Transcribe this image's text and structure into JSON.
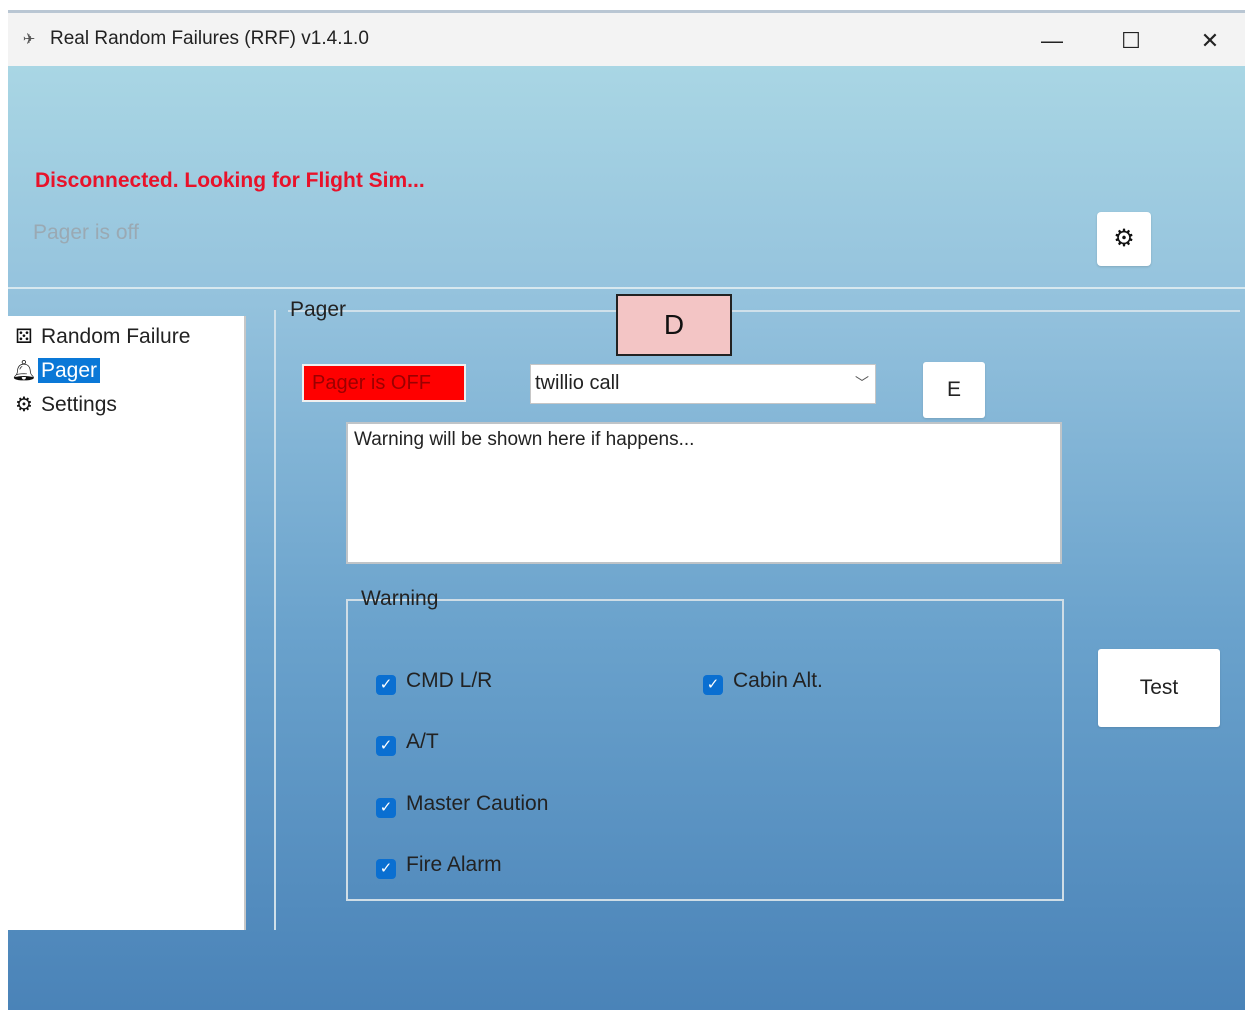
{
  "window": {
    "title": "Real Random Failures (RRF) v1.4.1.0",
    "app_icon": "airplane-icon",
    "controls": {
      "minimize": "—",
      "maximize": "☐",
      "close": "✕"
    }
  },
  "status": {
    "connection": "Disconnected. Looking for Flight Sim...",
    "pager_status": "Pager is off",
    "settings_icon": "gear-icon"
  },
  "sidebar": {
    "items": [
      {
        "label": "Random Failure",
        "icon": "dice-icon",
        "selected": false
      },
      {
        "label": "Pager",
        "icon": "bell-icon",
        "selected": true
      },
      {
        "label": "Settings",
        "icon": "gear-icon",
        "selected": false
      }
    ]
  },
  "pager_panel": {
    "group_title": "Pager",
    "overlay_label_d": "D",
    "toggle_label": "Pager is OFF",
    "method_select": {
      "value": "twillio call"
    },
    "edit_button": "E",
    "warning_text": "Warning will be shown here if happens...",
    "test_button": "Test"
  },
  "warning_group": {
    "title": "Warning",
    "checkboxes": [
      {
        "label": "CMD L/R",
        "checked": true
      },
      {
        "label": "Cabin Alt.",
        "checked": true
      },
      {
        "label": "A/T",
        "checked": true
      },
      {
        "label": "Master Caution",
        "checked": true
      },
      {
        "label": "Fire Alarm",
        "checked": true
      }
    ]
  },
  "colors": {
    "status_error": "#e8122a",
    "pager_off_bg": "#ff0000",
    "selection": "#0a78d7",
    "checkbox": "#0a6fd1"
  }
}
